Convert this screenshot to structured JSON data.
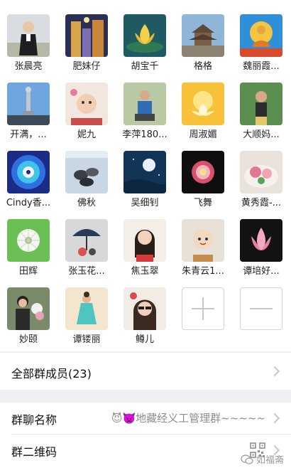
{
  "members": [
    {
      "name": "张晨亮",
      "icon": "boy-avatar"
    },
    {
      "name": "肥妹仔",
      "icon": "street-avatar"
    },
    {
      "name": "胡宝千",
      "icon": "lotus-avatar"
    },
    {
      "name": "格格",
      "icon": "temple-avatar"
    },
    {
      "name": "魏丽霞...",
      "icon": "buddha-avatar"
    },
    {
      "name": "开满，...",
      "icon": "statue-avatar"
    },
    {
      "name": "妮九",
      "icon": "baby-avatar"
    },
    {
      "name": "李萍180...",
      "icon": "person-avatar"
    },
    {
      "name": "周淑媚",
      "icon": "golden-lotus-avatar"
    },
    {
      "name": "大顺妈...",
      "icon": "child-avatar"
    },
    {
      "name": "Cindy香...",
      "icon": "mandala-avatar"
    },
    {
      "name": "佛秋",
      "icon": "stones-avatar"
    },
    {
      "name": "吴细钊",
      "icon": "moon-avatar"
    },
    {
      "name": "飞舞",
      "icon": "rose-avatar"
    },
    {
      "name": "黄秀霞-...",
      "icon": "cake-avatar"
    },
    {
      "name": "田辉",
      "icon": "dandelion-avatar"
    },
    {
      "name": "张玉花...",
      "icon": "umbrella-avatar"
    },
    {
      "name": "焦玉翠",
      "icon": "woman-avatar"
    },
    {
      "name": "朱青云1...",
      "icon": "monk-avatar"
    },
    {
      "name": "谭培好...",
      "icon": "pink-lotus-avatar"
    },
    {
      "name": "妙颐",
      "icon": "flowers-woman-avatar"
    },
    {
      "name": "谭镂丽",
      "icon": "dancer-avatar"
    },
    {
      "name": "鳟儿",
      "icon": "sunglasses-avatar"
    }
  ],
  "actions": {
    "add_icon": "plus-icon",
    "remove_icon": "minus-icon"
  },
  "all_members": {
    "label": "全部群成员(23)"
  },
  "group_name": {
    "label": "群聊名称",
    "emoji": "😈👿",
    "value": "地藏经义工管理群~~~~~"
  },
  "group_qr": {
    "label": "群二维码",
    "icon": "qr-code-icon"
  },
  "watermark": {
    "text": "如福斋",
    "icon": "wechat-icon"
  },
  "colors": {
    "background": "#efeff4",
    "card": "#ffffff",
    "chevron": "#c7c7cc",
    "secondary_text": "#8e8e8e"
  }
}
